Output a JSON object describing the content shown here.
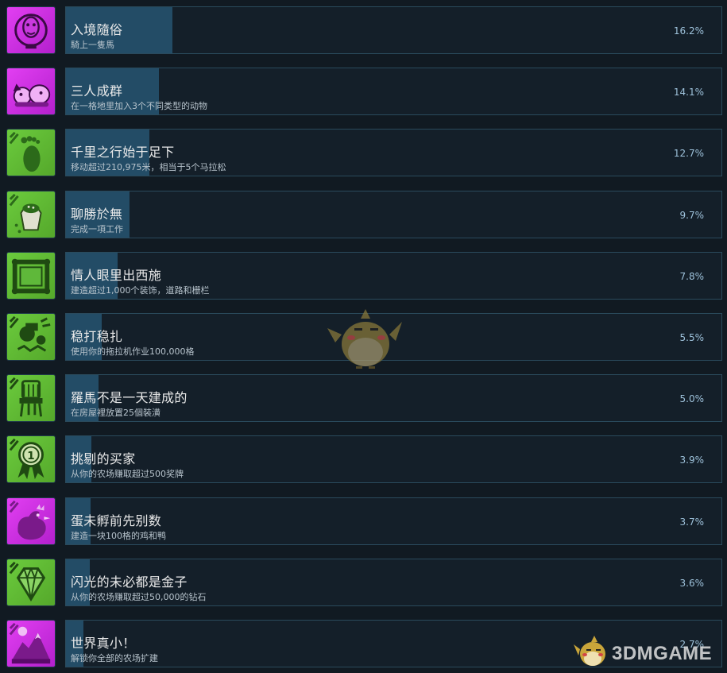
{
  "achievements": [
    {
      "title": "入境隨俗",
      "desc": "騎上一隻馬",
      "pct": "16.2%",
      "fraction": 0.162,
      "icon": "horse-knocker-icon",
      "color": "magenta"
    },
    {
      "title": "三人成群",
      "desc": "在一格地里加入3个不同类型的动物",
      "pct": "14.1%",
      "fraction": 0.141,
      "icon": "farm-animals-icon",
      "color": "magenta"
    },
    {
      "title": "千里之行始于足下",
      "desc": "移动超过210,975米，相当于5个马拉松",
      "pct": "12.7%",
      "fraction": 0.127,
      "icon": "footprint-icon",
      "color": "green"
    },
    {
      "title": "聊勝於無",
      "desc": "完成一項工作",
      "pct": "9.7%",
      "fraction": 0.097,
      "icon": "salt-shaker-icon",
      "color": "green"
    },
    {
      "title": "情人眼里出西施",
      "desc": "建造超过1,000个装饰，道路和栅栏",
      "pct": "7.8%",
      "fraction": 0.078,
      "icon": "picture-frame-icon",
      "color": "green"
    },
    {
      "title": "稳打稳扎",
      "desc": "使用你的拖拉机作业100,000格",
      "pct": "5.5%",
      "fraction": 0.055,
      "icon": "tractor-crash-icon",
      "color": "green"
    },
    {
      "title": "羅馬不是一天建成的",
      "desc": "在房屋裡放置25個裝潢",
      "pct": "5.0%",
      "fraction": 0.05,
      "icon": "chair-icon",
      "color": "green"
    },
    {
      "title": "挑剔的买家",
      "desc": "从你的农场赚取超过500奖牌",
      "pct": "3.9%",
      "fraction": 0.039,
      "icon": "medal-icon",
      "color": "green"
    },
    {
      "title": "蛋未孵前先别数",
      "desc": "建造一块100格的鸡和鸭",
      "pct": "3.7%",
      "fraction": 0.037,
      "icon": "rooster-icon",
      "color": "magenta"
    },
    {
      "title": "闪光的未必都是金子",
      "desc": "从你的农场赚取超过50,000的钻石",
      "pct": "3.6%",
      "fraction": 0.036,
      "icon": "diamond-icon",
      "color": "green"
    },
    {
      "title": "世界真小！",
      "desc": "解锁你全部的农场扩建",
      "pct": "2.7%",
      "fraction": 0.027,
      "icon": "mountain-icon",
      "color": "magenta"
    }
  ],
  "watermark": {
    "text": "3DMGAME",
    "mascot": "bird-mascot-icon"
  }
}
